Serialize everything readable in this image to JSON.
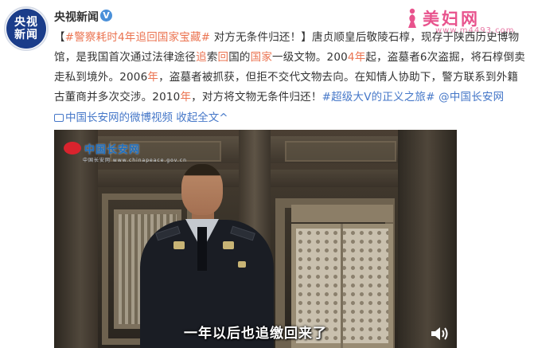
{
  "author": {
    "avatar_line1": "央视",
    "avatar_line2": "新闻",
    "name": "央视新闻",
    "verified_mark": "V"
  },
  "watermark": {
    "brand": "美妇网",
    "url": "www.m4493.com"
  },
  "post": {
    "hashtag_open": "【",
    "hashtag": "#警察耗时4年追回国家宝藏#",
    "title_rest": " 对方无条件归还！】",
    "seg1": "唐贞顺皇后敬陵石椁，现存于陕西历史博物馆，是我国首次通过法律途径",
    "seg_zhui": "追",
    "seg2": "索",
    "seg_hui": "回",
    "seg3": "国的",
    "seg_guojia": "国家",
    "seg4": "一级文物。200",
    "seg_4nian": "4年",
    "seg5": "起，盗墓者6次盗掘，将石椁倒卖走私到境外。2006",
    "seg_nian1": "年",
    "seg6": "，盗墓者被抓获，但拒不交代文物去向。在知情人协助下，警方联系到外籍古董商并多次交涉。2010",
    "seg_nian2": "年",
    "seg7": "，对方将文物无条件归还！",
    "topic": "#超级大V的正义之旅#",
    "mention": " @中国长安网"
  },
  "meta": {
    "video_source": "中国长安网的微博视频",
    "collapse_label": "收起全文",
    "collapse_caret": "^"
  },
  "video": {
    "logo_text": "中国长安网",
    "logo_sub": "中国长安网 www.chinapeace.gov.cn",
    "subtitle": "一年以后也追缴回来了"
  },
  "colors": {
    "link_orange": "#eb7350",
    "link_blue": "#4577c8",
    "brand_pink": "#e8538d"
  }
}
